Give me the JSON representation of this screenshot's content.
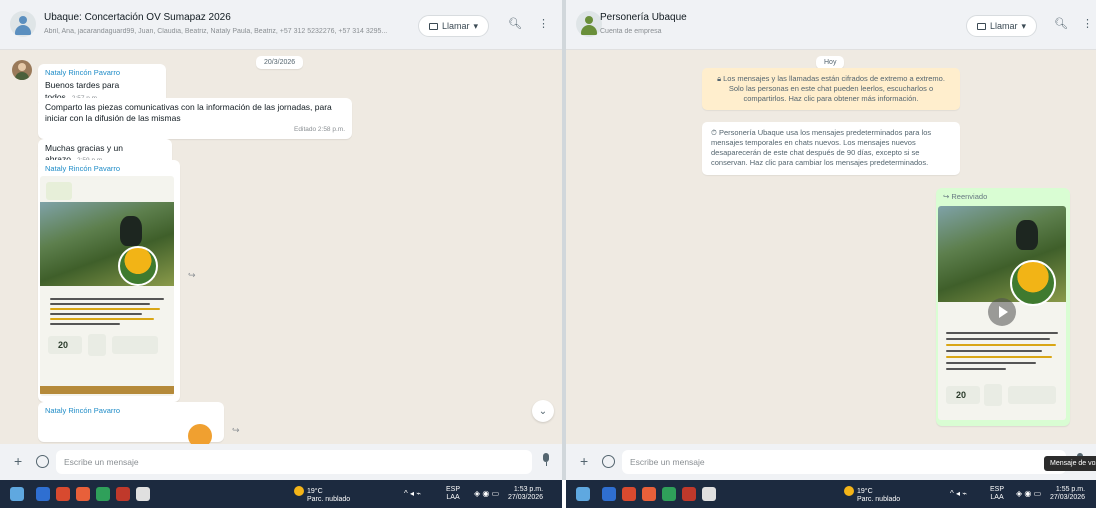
{
  "left_chat": {
    "title": "Ubaque: Concertación OV Sumapaz 2026",
    "subtitle": "Abril, Ana, jacarandaguard99, Juan, Claudia, Beatriz, Nataly Paula, Beatriz, +57 312 5232276, +57 314 3295...",
    "call_label": "Llamar",
    "date_chip": "20/3/2026",
    "messages": [
      {
        "sender": "Nataly Rincón Pavarro",
        "text": "Buenos tardes para todos",
        "time": "2:57 p.m."
      },
      {
        "text": "Comparto las piezas comunicativas con la información de las jornadas, para iniciar con la difusión de las mismas",
        "time": "Editado 2:58 p.m."
      },
      {
        "text": "Muchas gracias y un abrazo",
        "time": "2:59 p.m."
      },
      {
        "sender": "Nataly Rincón Pavarro"
      },
      {
        "sender": "Nataly Rincón Pavarro"
      }
    ],
    "poster_number": "20",
    "input_placeholder": "Escribe un mensaje"
  },
  "right_chat": {
    "title": "Personería Ubaque",
    "subtitle": "Cuenta de empresa",
    "call_label": "Llamar",
    "date_chip": "Hoy",
    "encryption_note": "Los mensajes y las llamadas están cifrados de extremo a extremo. Solo las personas en este chat pueden leerlos, escucharlos o compartirlos. Haz clic para obtener más información.",
    "disappearing_note": "Personería Ubaque usa los mensajes predeterminados para los mensajes temporales en chats nuevos. Los mensajes nuevos desaparecerán de este chat después de 90 días, excepto si se conservan. Haz clic para cambiar los mensajes predeterminados.",
    "forwarded_label": "Reenviado",
    "poster_number": "20",
    "input_placeholder": "Escribe un mensaje",
    "tooltip": "Mensaje de voz"
  },
  "taskbar_left": {
    "weather_temp": "19°C",
    "weather_desc": "Parc. nublado",
    "lang_1": "ESP",
    "lang_2": "LAA",
    "time": "1:53 p.m.",
    "date": "27/03/2026"
  },
  "taskbar_right": {
    "weather_temp": "19°C",
    "weather_desc": "Parc. nublado",
    "lang_1": "ESP",
    "lang_2": "LAA",
    "time": "1:55 p.m.",
    "date": "27/03/2026"
  },
  "colors": {
    "chat_bg": "#efeae2",
    "header_bg": "#f0f2f5",
    "sender_blue": "#1f8cc7",
    "outgoing_bubble": "#d9fdd3",
    "taskbar": "#1c2a3f",
    "encryption_yellow": "#ffeecd"
  },
  "icons": [
    "group-avatar-icon",
    "video-call-icon",
    "search-icon",
    "menu-dots-icon",
    "plus-icon",
    "sticker-icon",
    "microphone-icon",
    "forward-icon",
    "chevron-down-icon",
    "play-icon",
    "lock-icon",
    "timer-icon",
    "windows-start-icon"
  ]
}
